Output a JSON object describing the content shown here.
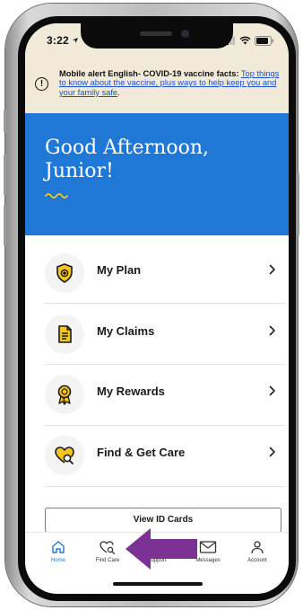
{
  "status_bar": {
    "time": "3:22"
  },
  "alert": {
    "lead": "Mobile alert English- COVID-19 vaccine facts:",
    "link": "Top things to know about the vaccine, plus ways to help keep you and your family safe",
    "trail": "."
  },
  "hero": {
    "greeting": "Good Afternoon, Junior!"
  },
  "menu": {
    "items": [
      {
        "label": "My Plan",
        "icon": "shield-icon"
      },
      {
        "label": "My Claims",
        "icon": "document-icon"
      },
      {
        "label": "My Rewards",
        "icon": "award-ribbon-icon"
      },
      {
        "label": "Find & Get Care",
        "icon": "heart-search-icon"
      }
    ]
  },
  "id_cards_button": "View ID Cards",
  "tabbar": {
    "tabs": [
      {
        "label": "Home",
        "icon": "home-icon"
      },
      {
        "label": "Find Care",
        "icon": "heart-search-icon"
      },
      {
        "label": "Support",
        "icon": "support-icon"
      },
      {
        "label": "Messages",
        "icon": "mail-icon"
      },
      {
        "label": "Account",
        "icon": "person-icon"
      }
    ]
  },
  "colors": {
    "hero_blue": "#1f78d6",
    "alert_bg": "#f2ead8",
    "accent_yellow": "#f7c61e",
    "arrow_purple": "#7b3294"
  }
}
